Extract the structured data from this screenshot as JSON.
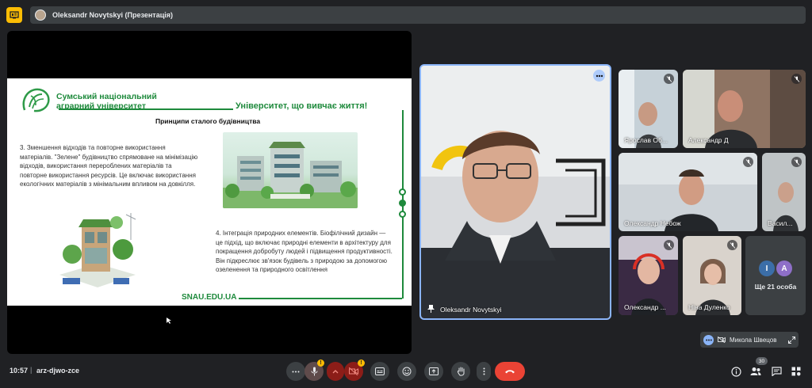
{
  "window": {
    "presenter_title": "Oleksandr Novytskyi (Презентація)"
  },
  "slide": {
    "university_name": "Сумський національний аграрний університет",
    "tagline": "Університет, що вивчає життя!",
    "heading": "Принципи сталого будівництва",
    "paragraph_1": "3. Зменшення відходів та повторне використання матеріалів. \"Зелене\" будівництво спрямоване на мінімізацію відходів, використання перероблених матеріалів та повторне використання ресурсів. Це включає використання екологічних матеріалів з мінімальним впливом на довкілля.",
    "paragraph_2": "4. Інтеграція природних елементів. Біофілічний дизайн — це підхід, що включає природні елементи в архітектуру для покращення добробуту людей і підвищення продуктивності. Він підкреслює зв'язок будівель з природою за допомогою озеленення та природного освітлення",
    "website": "SNAU.EDU.UA",
    "accent_color": "#1e8a3c"
  },
  "speaker": {
    "name": "Oleksandr Novytskyi"
  },
  "participants": [
    {
      "name": "Ярослав Об...",
      "muted": true
    },
    {
      "name": "Александр Д",
      "muted": true
    },
    {
      "name": "Олександр Небож",
      "muted": true
    },
    {
      "name": "Васил...",
      "muted": true
    },
    {
      "name": "Олександр ...",
      "muted": true
    },
    {
      "name": "Ніна Дуленко",
      "muted": true
    }
  ],
  "others": {
    "avatar_1": "І",
    "avatar_2": "А",
    "label": "Ще 21 особа"
  },
  "self_view": {
    "name": "Микола Швецов"
  },
  "bottom_bar": {
    "time": "10:57",
    "separator": "|",
    "meeting_code": "arz-djwo-zce",
    "people_count": "30"
  },
  "icons": {
    "app": "presentation-icon",
    "mic": "mic-icon",
    "camera": "camera-off-icon",
    "captions": "captions-icon",
    "emoji": "emoji-icon",
    "present": "present-icon",
    "hand": "raise-hand-icon",
    "more": "more-vert-icon",
    "hangup": "hangup-icon",
    "info": "info-icon",
    "people": "people-icon",
    "chat": "chat-icon",
    "activities": "activities-icon"
  }
}
